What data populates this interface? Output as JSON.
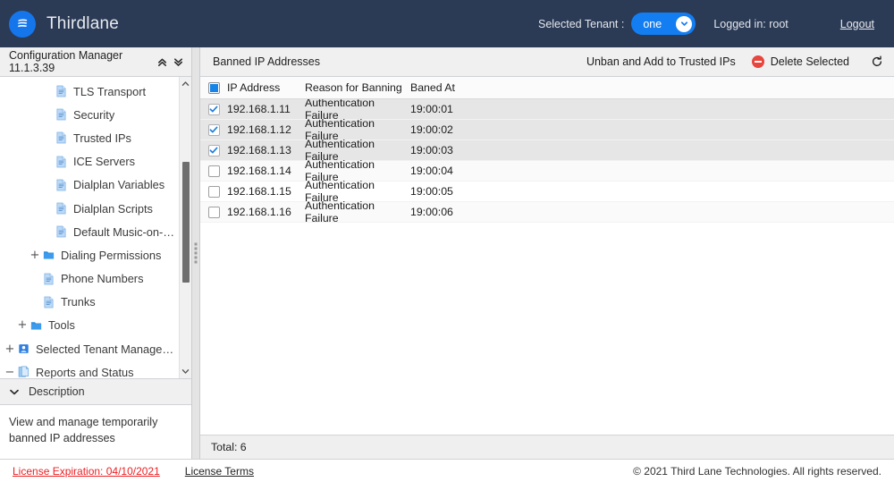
{
  "header": {
    "brand": "Thirdlane",
    "logo_icon": "thirdlane-wave-logo",
    "tenant_label": "Selected Tenant :",
    "tenant_value": "one",
    "tenant_caret_icon": "chevron-down-icon",
    "logged_in": "Logged in: root",
    "logout": "Logout",
    "bg_color": "#2b3a55",
    "accent_color": "#127ef2"
  },
  "sidebar": {
    "title": "Configuration Manager 11.1.3.39",
    "collapse_icon": "double-chevron-up-icon",
    "expand_icon": "double-chevron-down-icon",
    "scroll_up_icon": "chevron-up-icon",
    "scroll_down_icon": "chevron-down-icon",
    "tree": [
      {
        "label": "TLS Transport",
        "icon": "page-icon",
        "expander": "",
        "indent": 3
      },
      {
        "label": "Security",
        "icon": "page-icon",
        "expander": "",
        "indent": 3
      },
      {
        "label": "Trusted IPs",
        "icon": "page-icon",
        "expander": "",
        "indent": 3
      },
      {
        "label": "ICE Servers",
        "icon": "page-icon",
        "expander": "",
        "indent": 3
      },
      {
        "label": "Dialplan Variables",
        "icon": "page-icon",
        "expander": "",
        "indent": 3
      },
      {
        "label": "Dialplan Scripts",
        "icon": "page-icon",
        "expander": "",
        "indent": 3
      },
      {
        "label": "Default Music-on-Hold",
        "icon": "page-icon",
        "expander": "",
        "indent": 3
      },
      {
        "label": "Dialing Permissions",
        "icon": "folder-icon",
        "expander": "+",
        "indent": 2
      },
      {
        "label": "Phone Numbers",
        "icon": "page-icon",
        "expander": "",
        "indent": 2
      },
      {
        "label": "Trunks",
        "icon": "page-icon",
        "expander": "",
        "indent": 2
      },
      {
        "label": "Tools",
        "icon": "folder-icon",
        "expander": "+",
        "indent": 1
      },
      {
        "label": "Selected Tenant Management",
        "icon": "user-card-icon",
        "expander": "+",
        "indent": 0
      },
      {
        "label": "Reports and Status",
        "icon": "pages-icon",
        "expander": "−",
        "indent": 0
      }
    ],
    "description": {
      "header": "Description",
      "caret_icon": "chevron-down-icon",
      "text": "View and manage temporarily banned IP addresses"
    }
  },
  "splitter": {
    "grip_icon": "drag-grip-icon"
  },
  "main": {
    "panel_title": "Banned IP Addresses",
    "actions": {
      "unban": "Unban and Add to Trusted IPs",
      "delete": "Delete Selected",
      "delete_icon": "delete-circle-icon",
      "refresh_icon": "refresh-icon"
    },
    "grid": {
      "select_all_state": "indeterminate",
      "columns": [
        "IP Address",
        "Reason for Banning",
        "Baned At"
      ],
      "rows": [
        {
          "selected": true,
          "ip": "192.168.1.11",
          "reason": "Authentication Failure",
          "banned_at": "19:00:01"
        },
        {
          "selected": true,
          "ip": "192.168.1.12",
          "reason": "Authentication Failure",
          "banned_at": "19:00:02"
        },
        {
          "selected": true,
          "ip": "192.168.1.13",
          "reason": "Authentication Failure",
          "banned_at": "19:00:03"
        },
        {
          "selected": false,
          "ip": "192.168.1.14",
          "reason": "Authentication Failure",
          "banned_at": "19:00:04"
        },
        {
          "selected": false,
          "ip": "192.168.1.15",
          "reason": "Authentication Failure",
          "banned_at": "19:00:05"
        },
        {
          "selected": false,
          "ip": "192.168.1.16",
          "reason": "Authentication Failure",
          "banned_at": "19:00:06"
        }
      ],
      "total": "Total: 6"
    }
  },
  "footer": {
    "license_expiration": "License Expiration: 04/10/2021",
    "license_expiration_color": "#ec2024",
    "license_terms": "License Terms",
    "copyright": "© 2021 Third Lane Technologies. All rights reserved."
  }
}
